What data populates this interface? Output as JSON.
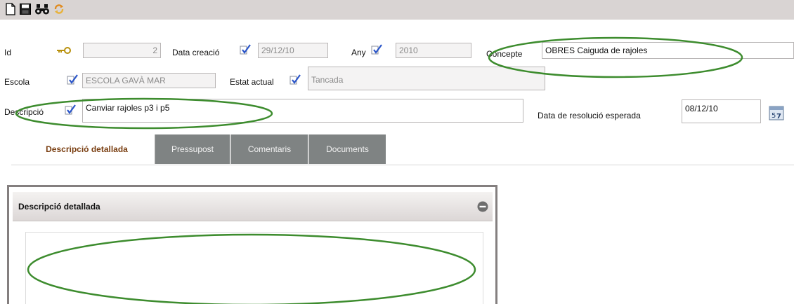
{
  "toolbar": {
    "icons": [
      "new-document-icon",
      "save-icon",
      "binoculars-icon",
      "refresh-icon"
    ]
  },
  "form": {
    "id": {
      "label": "Id",
      "value": "2"
    },
    "data_creacio": {
      "label": "Data creació",
      "value": "29/12/10"
    },
    "any": {
      "label": "Any",
      "value": "2010"
    },
    "concepte": {
      "label": "Concepte",
      "value": "OBRES Caiguda de rajoles"
    },
    "escola": {
      "label": "Escola",
      "value": "ESCOLA GAVÀ MAR"
    },
    "estat_actual": {
      "label": "Estat actual",
      "value": "Tancada"
    },
    "descripcio": {
      "label": "Descripció",
      "value": "Canviar rajoles p3 i p5"
    },
    "data_resolucio": {
      "label": "Data de resolució esperada",
      "value": "08/12/10"
    }
  },
  "tabs": [
    {
      "label": "Descripció detallada",
      "active": true
    },
    {
      "label": "Pressupost",
      "active": false
    },
    {
      "label": "Comentaris",
      "active": false
    },
    {
      "label": "Documents",
      "active": false
    }
  ],
  "panel": {
    "title": "Descripció detallada",
    "content": ""
  },
  "colors": {
    "toolbar_bg": "#d9d4d3",
    "tab_inactive_bg": "#7f8383",
    "tab_active_text": "#7a3f12",
    "highlight_ellipse": "#3d8c2e"
  }
}
